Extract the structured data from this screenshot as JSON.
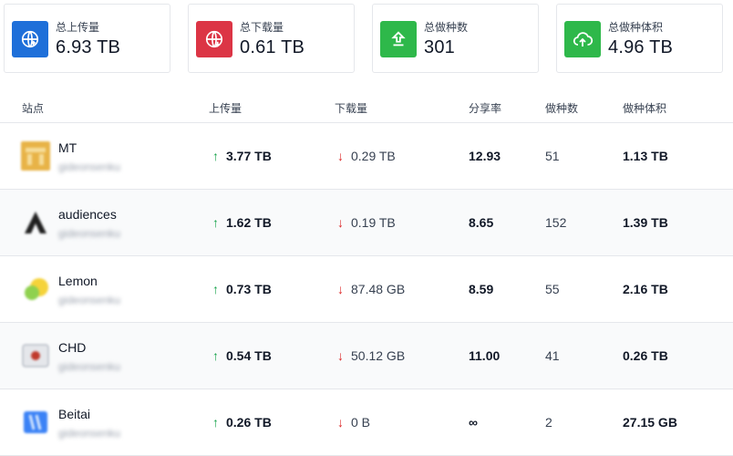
{
  "summary": [
    {
      "label": "总上传量",
      "value": "6.93 TB",
      "icon": "globe-upload-icon",
      "color": "#1e6fd9"
    },
    {
      "label": "总下载量",
      "value": "0.61 TB",
      "icon": "globe-download-icon",
      "color": "#dc3545"
    },
    {
      "label": "总做种数",
      "value": "301",
      "icon": "upload-arrow-icon",
      "color": "#2eb84a"
    },
    {
      "label": "总做种体积",
      "value": "4.96 TB",
      "icon": "cloud-upload-icon",
      "color": "#2eb84a"
    }
  ],
  "table": {
    "headers": {
      "site": "站点",
      "upload": "上传量",
      "download": "下载量",
      "ratio": "分享率",
      "seeds": "做种数",
      "seed_size": "做种体积"
    },
    "rows": [
      {
        "site": "MT",
        "user": "gideonsenku",
        "upload": "3.77 TB",
        "download": "0.29 TB",
        "ratio": "12.93",
        "seeds": "51",
        "seed_size": "1.13 TB"
      },
      {
        "site": "audiences",
        "user": "gideonsenku",
        "upload": "1.62 TB",
        "download": "0.19 TB",
        "ratio": "8.65",
        "seeds": "152",
        "seed_size": "1.39 TB"
      },
      {
        "site": "Lemon",
        "user": "gideonsenku",
        "upload": "0.73 TB",
        "download": "87.48 GB",
        "ratio": "8.59",
        "seeds": "55",
        "seed_size": "2.16 TB"
      },
      {
        "site": "CHD",
        "user": "gideonsenku",
        "upload": "0.54 TB",
        "download": "50.12 GB",
        "ratio": "11.00",
        "seeds": "41",
        "seed_size": "0.26 TB"
      },
      {
        "site": "Beitai",
        "user": "gideonsenku",
        "upload": "0.26 TB",
        "download": "0 B",
        "ratio": "∞",
        "seeds": "2",
        "seed_size": "27.15 GB"
      }
    ]
  },
  "arrows": {
    "up": "↑",
    "down": "↓"
  }
}
